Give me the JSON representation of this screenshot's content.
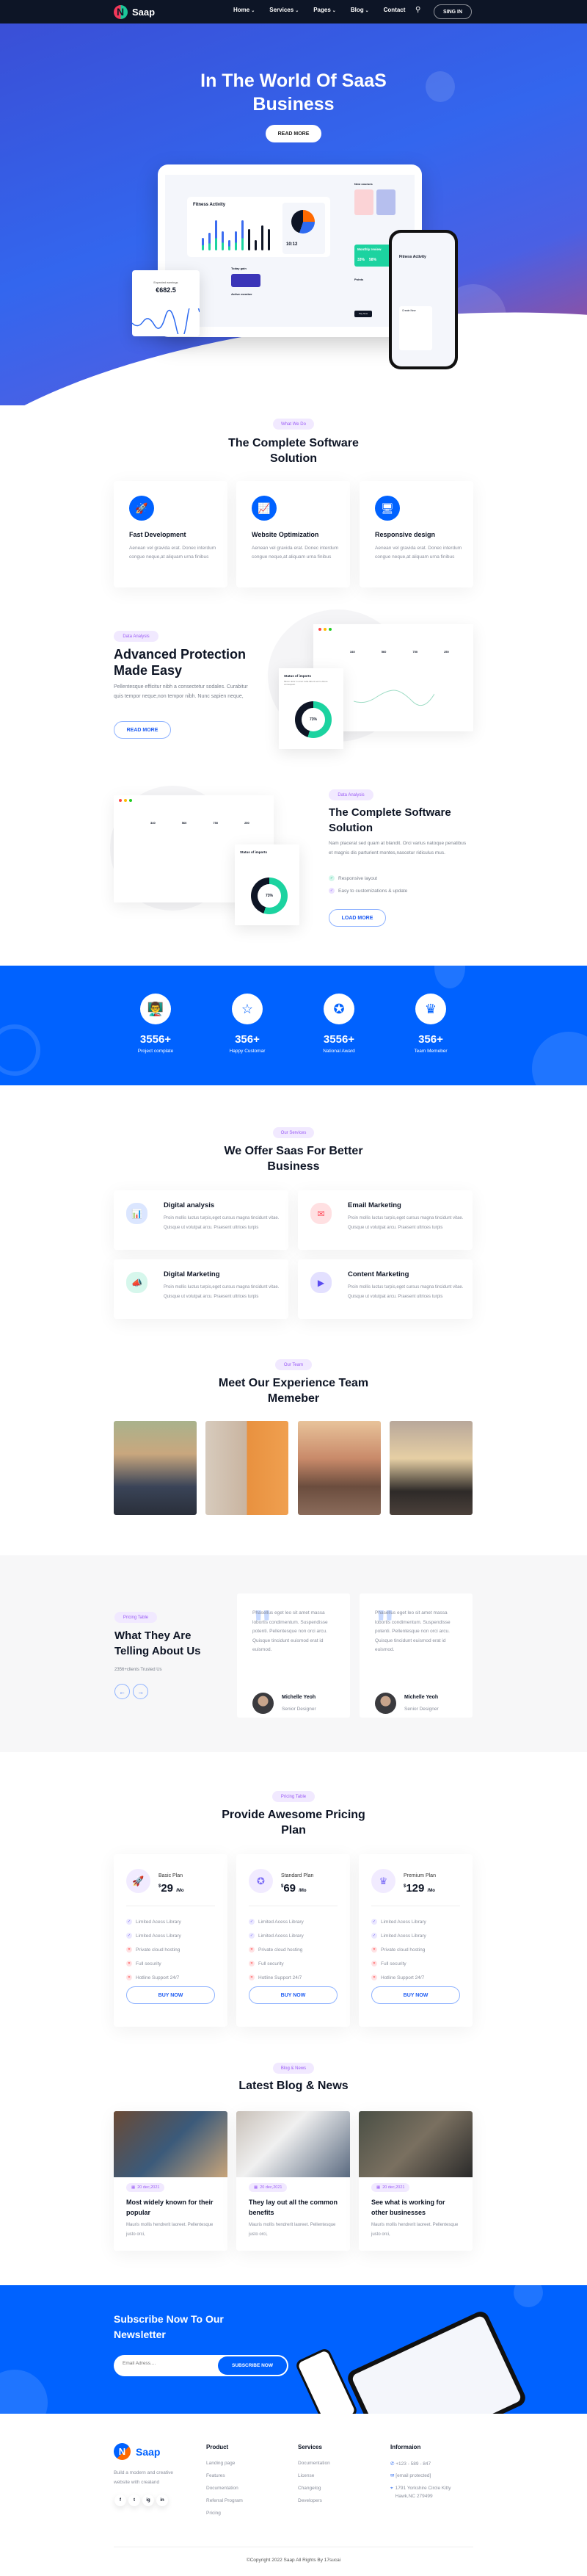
{
  "nav": {
    "brand": "Saap",
    "items": [
      {
        "label": "Home",
        "dropdown": true
      },
      {
        "label": "Services",
        "dropdown": true
      },
      {
        "label": "Pages",
        "dropdown": true
      },
      {
        "label": "Blog",
        "dropdown": true
      },
      {
        "label": "Contact",
        "dropdown": false
      }
    ],
    "signin": "SING IN"
  },
  "hero": {
    "title": "In The World Of SaaS Business",
    "button": "READ MORE",
    "mockup": {
      "fitness_title": "Fitness Activity",
      "clock": "10:12",
      "new_courses": "New courses",
      "monthly_review": "Monthly review",
      "monthly_values": [
        "33%",
        "58%"
      ],
      "points": "Points",
      "points_value": "60d",
      "pay_now": "Pay Now",
      "today_gain": "Today gain",
      "active_member": "Active member",
      "create_new": "Create New",
      "earnings_label": "Expected earnings",
      "earnings_value": "€682.5"
    }
  },
  "whatwedo": {
    "tag": "What We Do",
    "title": "The Complete Software Solution",
    "cards": [
      {
        "icon": "rocket-icon",
        "title": "Fast Development",
        "text": "Aenean vel gravida erat. Donec interdum congue neque,at aliquam urna finibus"
      },
      {
        "icon": "monitor-chart-icon",
        "title": "Website Optimization",
        "text": "Aenean vel gravida erat. Donec interdum congue neque,at aliquam urna finibus"
      },
      {
        "icon": "devices-icon",
        "title": "Responsive design",
        "text": "Aenean vel gravida erat. Donec interdum congue neque,at aliquam urna finibus"
      }
    ]
  },
  "feature1": {
    "tag": "Data Analysis",
    "title": "Advanced Protection Made Easy",
    "text": "Pellentesque efficitur nibh a consectetur sodales. Curabitur quis tempor neque,non tempor nibh. Nunc sapien neque,",
    "button": "READ MORE",
    "mockup": {
      "stats": [
        "340",
        "560",
        "750",
        "250"
      ],
      "status_title": "Status of imports",
      "status_text": "Minim dolor in amet nulla laboris enim dolore consequatt.",
      "percent": "73%"
    }
  },
  "feature2": {
    "tag": "Data Analysis",
    "title": "The Complete Software Solution",
    "text": "Nam placerat sed quam at blandit. Orci varius natoque penatibus et magnis dis parturient montes,nascetur ridiculus mus.",
    "checks": [
      "Responsive layout",
      "Easy to customizations & update"
    ],
    "button": "LOAD MORE",
    "mockup": {
      "stats": [
        "340",
        "560",
        "750",
        "250"
      ],
      "status_title": "Status of imports",
      "percent": "73%"
    }
  },
  "stats": [
    {
      "icon": "presentation-icon",
      "value": "3556+",
      "label": "Project complate"
    },
    {
      "icon": "customer-stars-icon",
      "value": "356+",
      "label": "Happy Customar"
    },
    {
      "icon": "award-medal-icon",
      "value": "3556+",
      "label": "National Award"
    },
    {
      "icon": "crown-icon",
      "value": "356+",
      "label": "Team Memeber"
    }
  ],
  "services": {
    "tag": "Our Services",
    "title": "We Offer Saas For Better Business",
    "items": [
      {
        "title": "Digital analysis",
        "text": "Proin mollis luctus turpis,eget cursus magna tincidunt vitae. Quisque ut volutpat arcu. Praesent ultrices turpis",
        "color": "#dbe6ff",
        "icon": "bar-chart-icon"
      },
      {
        "title": "Email Marketing",
        "text": "Proin mollis luctus turpis,eget cursus magna tincidunt vitae. Quisque ut volutpat arcu. Praesent ultrices turpis",
        "color": "#ffe0e2",
        "icon": "envelope-icon"
      },
      {
        "title": "Digital Marketing",
        "text": "Proin mollis luctus turpis,eget cursus magna tincidunt vitae. Quisque ut volutpat arcu. Praesent ultrices turpis",
        "color": "#d6f7ec",
        "icon": "megaphone-icon"
      },
      {
        "title": "Content Marketing",
        "text": "Proin mollis luctus turpis,eget cursus magna tincidunt vitae. Quisque ut volutpat arcu. Praesent ultrices turpis",
        "color": "#e3e0ff",
        "icon": "media-icon"
      }
    ]
  },
  "team": {
    "tag": "Our Team",
    "title": "Meet Our Experience Team Memeber"
  },
  "testimonials": {
    "tag": "Pricing Table",
    "title": "What They Are Telling About Us",
    "subtitle": "2356+clients Trusted Us",
    "items": [
      {
        "text": "Phasellus eget leo sit amet massa lobortis condimentum. Suspendisse potenti. Pellentesque non orci arcu. Quisque tincidunt euismod erat id euismod.",
        "name": "Michelle Yeoh",
        "role": "Senior Designer"
      },
      {
        "text": "Phasellus eget leo sit amet massa lobortis condimentum. Suspendisse potenti. Pellentesque non orci arcu. Quisque tincidunt euismod erat id euismod.",
        "name": "Michelle Yeoh",
        "role": "Senior Designer"
      }
    ]
  },
  "pricing": {
    "tag": "Pricing Table",
    "title": "Provide Awesome Pricing Plan",
    "plans": [
      {
        "name": "Basic Plan",
        "currency": "$",
        "price": "29",
        "period": "/Mo",
        "icon": "rocket-icon"
      },
      {
        "name": "Standard Plan",
        "currency": "$",
        "price": "69",
        "period": "/Mo",
        "icon": "award-medal-icon"
      },
      {
        "name": "Premium Plan",
        "currency": "$",
        "price": "129",
        "period": "/Mo",
        "icon": "crown-icon"
      }
    ],
    "features": [
      {
        "label": "Limited Acess Library",
        "included": true
      },
      {
        "label": "Limited Acess Library",
        "included": true
      },
      {
        "label": "Private cloud hosting",
        "included": false
      },
      {
        "label": "Full security",
        "included": false
      },
      {
        "label": "Hotline Support 24/7",
        "included": false
      }
    ],
    "button": "BUY NOW"
  },
  "blog": {
    "tag": "Blog & News",
    "title": "Latest Blog & News",
    "posts": [
      {
        "date": "20 dec,2021",
        "title": "Most widely known for their popular",
        "text": "Mauris mollis hendrerit laoreet. Pellentesque justo orci,"
      },
      {
        "date": "20 dec,2021",
        "title": "They lay out all the common benefits",
        "text": "Mauris mollis hendrerit laoreet. Pellentesque justo orci,"
      },
      {
        "date": "20 dec,2021",
        "title": "See what is working for other businesses",
        "text": "Mauris mollis hendrerit laoreet. Pellentesque justo orci,"
      }
    ]
  },
  "newsletter": {
    "title": "Subscribe Now To Our Newsletter",
    "placeholder": "Email Adress....",
    "button": "SUBSCRIBE NOW"
  },
  "footer": {
    "brand": "Saap",
    "tagline": "Build a modern and creative website with crealand",
    "social": [
      "f",
      "t",
      "ig",
      "in"
    ],
    "product": {
      "title": "Product",
      "links": [
        "Landing page",
        "Features",
        "Documentation",
        "Referral Program",
        "Pricing"
      ]
    },
    "services": {
      "title": "Services",
      "links": [
        "Documentation",
        "License",
        "Changelog",
        "Developers"
      ]
    },
    "info": {
      "title": "Informaion",
      "phone": "+123 - 589 - 847",
      "email": "[email protected]",
      "address": "1791 Yorkshire Circle Kitty Hawk,NC 279499"
    },
    "copyright": "©Copyright 2022 Saap All Rights By 17sucai"
  },
  "colors": {
    "primary": "#0062ff",
    "nav": "#0d1526",
    "tag_bg": "#f1e9ff",
    "tag_text": "#9b5cf6"
  }
}
